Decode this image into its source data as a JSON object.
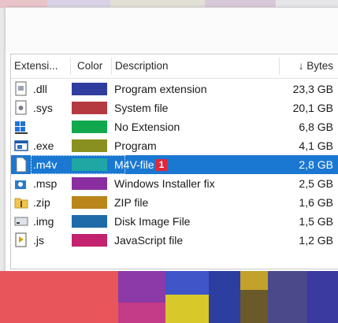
{
  "columns": {
    "extension": "Extensi...",
    "color": "Color",
    "description": "Description",
    "bytes": "↓ Bytes"
  },
  "rows": [
    {
      "ext": ".dll",
      "color": "#2f3d9e",
      "desc": "Program extension",
      "bytes": "23,3 GB",
      "icon": "dll-file-icon"
    },
    {
      "ext": ".sys",
      "color": "#b43a40",
      "desc": "System file",
      "bytes": "20,1 GB",
      "icon": "sys-file-icon"
    },
    {
      "ext": "",
      "color": "#12a84e",
      "desc": "No Extension",
      "bytes": "6,8 GB",
      "icon": "windows-logo-icon"
    },
    {
      "ext": ".exe",
      "color": "#8a9020",
      "desc": "Program",
      "bytes": "4,1 GB",
      "icon": "exe-window-icon"
    },
    {
      "ext": ".m4v",
      "color": "#1fa7a3",
      "desc": "M4V-file",
      "bytes": "2,8 GB",
      "icon": "blank-file-icon",
      "selected": true,
      "badge": "1"
    },
    {
      "ext": ".msp",
      "color": "#8a2da0",
      "desc": "Windows Installer fix",
      "bytes": "2,5 GB",
      "icon": "installer-icon"
    },
    {
      "ext": ".zip",
      "color": "#b8861b",
      "desc": "ZIP file",
      "bytes": "1,6 GB",
      "icon": "folder-zip-icon"
    },
    {
      "ext": ".img",
      "color": "#1f6aa8",
      "desc": "Disk Image File",
      "bytes": "1,5 GB",
      "icon": "disk-image-icon"
    },
    {
      "ext": ".js",
      "color": "#c2226e",
      "desc": "JavaScript file",
      "bytes": "1,2 GB",
      "icon": "javascript-file-icon"
    }
  ],
  "colors": {
    "selection": "#1a78d2",
    "badge": "#e3263a"
  }
}
